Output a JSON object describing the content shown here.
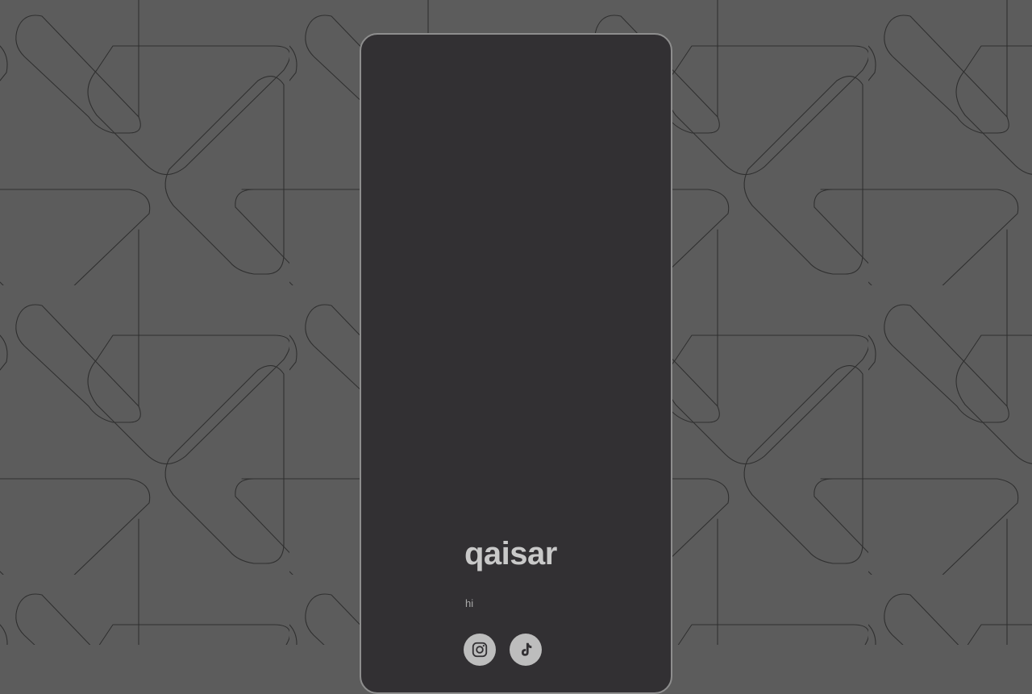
{
  "profile": {
    "name": "qaisar",
    "bio": "hi"
  },
  "social_links": [
    {
      "icon": "instagram-icon"
    },
    {
      "icon": "tiktok-icon"
    }
  ],
  "colors": {
    "background": "#5c5c5c",
    "pattern_stroke": "#2f2f2f",
    "card_background": "#323033",
    "card_border": "#8e8e8e",
    "name_text": "#c9c9c9",
    "bio_text": "#a9a9a9",
    "social_button": "#bdbdbd"
  }
}
